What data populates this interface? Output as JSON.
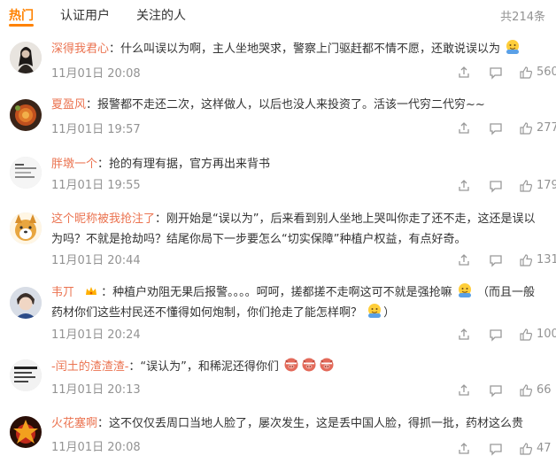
{
  "tabs": [
    {
      "label": "热门"
    },
    {
      "label": "认证用户"
    },
    {
      "label": "关注的人"
    }
  ],
  "total_count": "共214条",
  "comments": [
    {
      "user": "深得我君心",
      "sep": "：",
      "text": "什么叫误以为啊，主人坐地哭求，警察上门驱赶都不情不愿，还敢说误以为",
      "time": "11月01日 20:08",
      "likes": "560"
    },
    {
      "user": "夏盈风",
      "sep": "：",
      "text": "报警都不走还二次，这样做人，以后也没人来投资了。活该一代穷二代穷~~",
      "time": "11月01日 19:57",
      "likes": "277"
    },
    {
      "user": "胖墩一个",
      "sep": "：",
      "text": "抢的有理有据，官方再出来背书",
      "time": "11月01日 19:55",
      "likes": "179"
    },
    {
      "user": "这个昵称被我抢注了",
      "sep": "：",
      "text": "刚开始是“误以为”，后来看到别人坐地上哭叫你走了还不走，这还是误以为吗？不就是抢劫吗？结尾你局下一步要怎么“切实保障”种植户权益，有点好奇。",
      "time": "11月01日 20:44",
      "likes": "131"
    },
    {
      "user": "韦丌",
      "sep": "：",
      "text_a": "种植户劝阻无果后报警。。。。呵呵，搓都搓不走啊这可不就是强抢嘛",
      "text_b": "（而且一般药材你们这些村民还不懂得如何炮制，你们抢走了能怎样啊？",
      "text_c": "）",
      "time": "11月01日 20:24",
      "likes": "100"
    },
    {
      "user": "-闰土的渣渣渣-",
      "sep": "：",
      "text": "“误认为”，和稀泥还得你们",
      "time": "11月01日 20:13",
      "likes": "66"
    },
    {
      "user": "火花塞啊",
      "sep": "：",
      "text": "这不仅仅丢周口当地人脸了，屡次发生，这是丢中国人脸，得抓一批，药材这么贵",
      "time": "11月01日 20:08",
      "likes": "47"
    }
  ],
  "icons": {
    "share": "share-icon",
    "comment": "comment-icon",
    "like": "thumbs-up-icon",
    "emoji_hug": "hug-emoji-icon",
    "emoji_pig": "pig-face-emoji-icon",
    "badge": "crown-badge-icon"
  },
  "colors": {
    "accent": "#ff8200",
    "username": "#eb7350",
    "muted": "#939393",
    "text": "#333333"
  }
}
